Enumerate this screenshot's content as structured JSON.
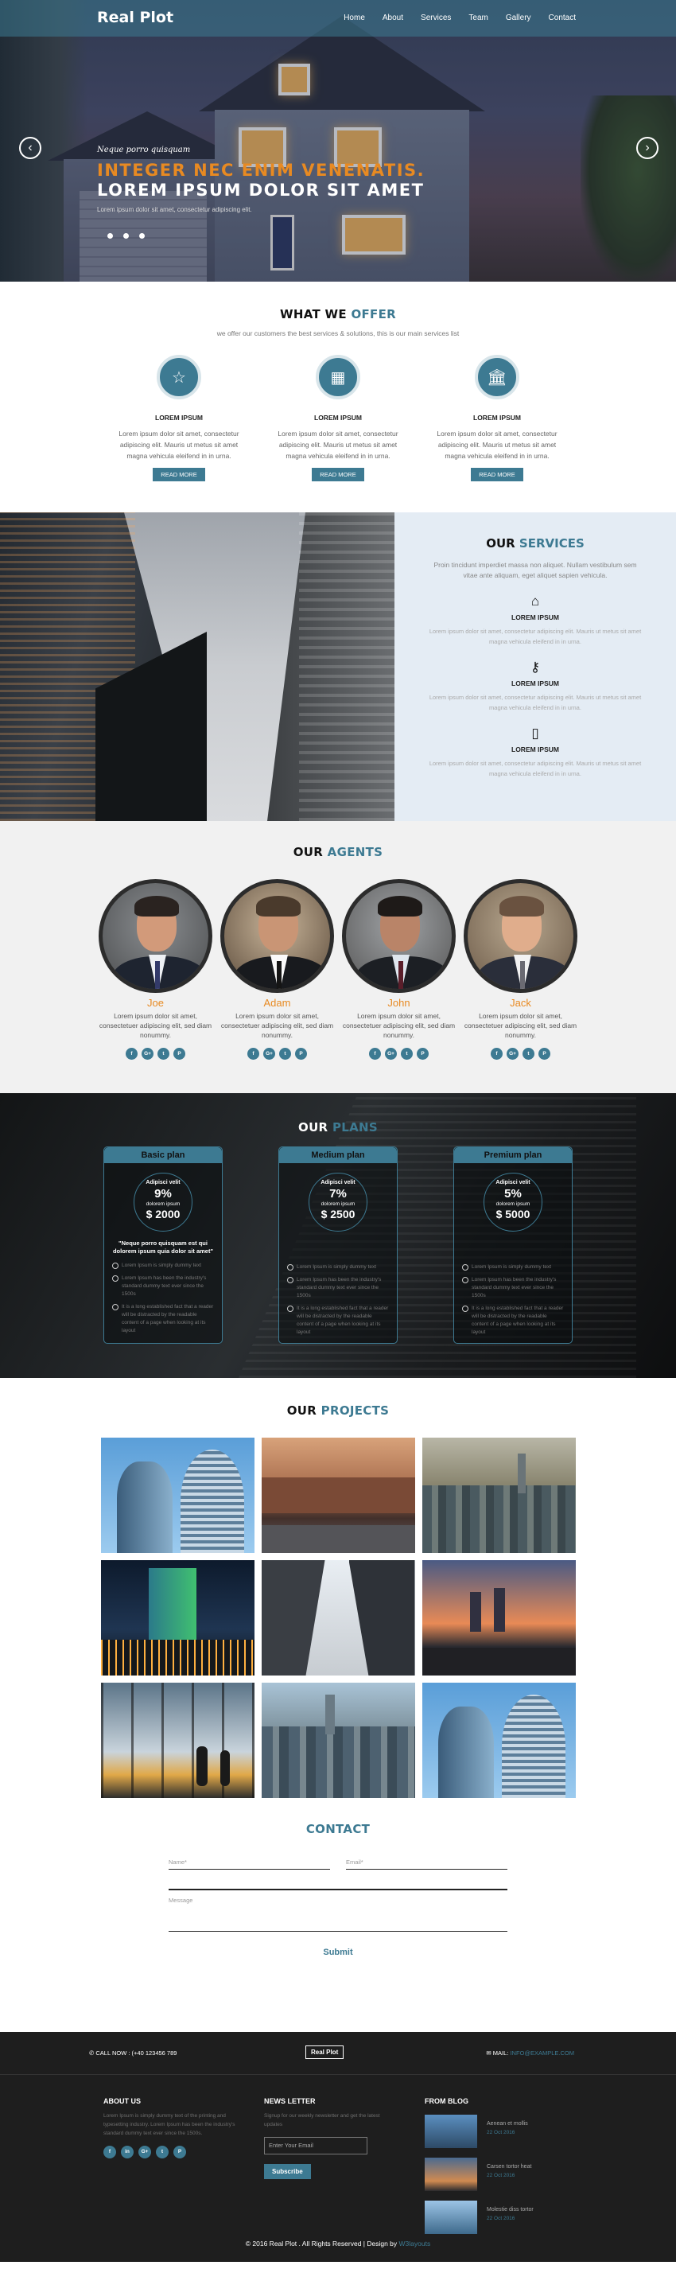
{
  "nav": {
    "logo": "Real Plot",
    "items": [
      "Home",
      "About",
      "Services",
      "Team",
      "Gallery",
      "Contact"
    ]
  },
  "hero": {
    "kicker": "Neque porro quisquam",
    "headline_a": "INTEGER NEC ENIM VENENATIS.",
    "headline_b": "LOREM IPSUM DOLOR SIT AMET",
    "text": "Lorem ipsum dolor sit amet, consectetur adipiscing elit.",
    "prev": "‹",
    "next": "›"
  },
  "offer": {
    "title_a": "WHAT WE",
    "title_b": "OFFER",
    "subtitle": "we offer our customers the best services & solutions, this is our main services list",
    "cards": [
      {
        "icon": "star-icon",
        "glyph": "☆",
        "title": "LOREM IPSUM",
        "text": "Lorem ipsum dolor sit amet, consectetur adipiscing elit. Mauris ut metus sit amet magna vehicula eleifend in in urna.",
        "button": "READ MORE"
      },
      {
        "icon": "map-icon",
        "glyph": "▦",
        "title": "LOREM IPSUM",
        "text": "Lorem ipsum dolor sit amet, consectetur adipiscing elit. Mauris ut metus sit amet magna vehicula eleifend in in urna.",
        "button": "READ MORE"
      },
      {
        "icon": "bank-icon",
        "glyph": "🏛",
        "title": "LOREM IPSUM",
        "text": "Lorem ipsum dolor sit amet, consectetur adipiscing elit. Mauris ut metus sit amet magna vehicula eleifend in in urna.",
        "button": "READ MORE"
      }
    ]
  },
  "services": {
    "title_a": "OUR",
    "title_b": "SERVICES",
    "lead": "Proin tincidunt imperdiet massa non aliquet. Nullam vestibulum sem vitae ante aliquam, eget aliquet sapien vehicula.",
    "items": [
      {
        "icon": "home-icon",
        "glyph": "⌂",
        "title": "LOREM IPSUM",
        "text": "Lorem ipsum dolor sit amet, consectetur adipiscing elit. Mauris ut metus sit amet magna vehicula eleifend in in urna."
      },
      {
        "icon": "key-icon",
        "glyph": "⚷",
        "title": "LOREM IPSUM",
        "text": "Lorem ipsum dolor sit amet, consectetur adipiscing elit. Mauris ut metus sit amet magna vehicula eleifend in in urna."
      },
      {
        "icon": "tablet-icon",
        "glyph": "▯",
        "title": "LOREM IPSUM",
        "text": "Lorem ipsum dolor sit amet, consectetur adipiscing elit. Mauris ut metus sit amet magna vehicula eleifend in in urna."
      }
    ]
  },
  "agents": {
    "title_a": "OUR",
    "title_b": "AGENTS",
    "list": [
      {
        "name": "Joe",
        "text": "Lorem ipsum dolor sit amet, consectetuer adipiscing elit, sed diam nonummy."
      },
      {
        "name": "Adam",
        "text": "Lorem ipsum dolor sit amet, consectetuer adipiscing elit, sed diam nonummy."
      },
      {
        "name": "John",
        "text": "Lorem ipsum dolor sit amet, consectetuer adipiscing elit, sed diam nonummy."
      },
      {
        "name": "Jack",
        "text": "Lorem ipsum dolor sit amet, consectetuer adipiscing elit, sed diam nonummy."
      }
    ],
    "social": [
      "f",
      "G+",
      "t",
      "P"
    ]
  },
  "plans": {
    "title_a": "OUR",
    "title_b": "PLANS",
    "list": [
      {
        "name": "Basic plan",
        "label": "Adipisci velit",
        "percent": "9%",
        "sublabel": "dolorem ipsum",
        "price": "$ 2000",
        "quote": "\"Neque porro quisquam est qui dolorem ipsum quia dolor sit amet\"",
        "features": [
          "Lorem Ipsum is simply dummy text",
          "Lorem Ipsum has been the industry's standard dummy text ever since the 1500s",
          "It is a long established fact that a reader will be distracted by the readable content of a page when looking at its layout"
        ]
      },
      {
        "name": "Medium plan",
        "label": "Adipisci velit",
        "percent": "7%",
        "sublabel": "dolorem ipsum",
        "price": "$ 2500",
        "quote": "",
        "features": [
          "Lorem Ipsum is simply dummy text",
          "Lorem Ipsum has been the industry's standard dummy text ever since the 1500s",
          "It is a long established fact that a reader will be distracted by the readable content of a page when looking at its layout"
        ]
      },
      {
        "name": "Premium plan",
        "label": "Adipisci velit",
        "percent": "5%",
        "sublabel": "dolorem ipsum",
        "price": "$ 5000",
        "quote": "",
        "features": [
          "Lorem Ipsum is simply dummy text",
          "Lorem Ipsum has been the industry's standard dummy text ever since the 1500s",
          "It is a long established fact that a reader will be distracted by the readable content of a page when looking at its layout"
        ]
      }
    ]
  },
  "projects": {
    "title_a": "OUR",
    "title_b": "PROJECTS"
  },
  "contact": {
    "title": "CONTACT",
    "name_placeholder": "Name*",
    "email_placeholder": "Email*",
    "message_placeholder": "Message",
    "submit": "Submit"
  },
  "footer": {
    "call": "CALL NOW : (+40 123456 789",
    "logo": "Real Plot",
    "mail_label": "MAIL:",
    "mail_value": "INFO@EXAMPLE.COM",
    "about_title": "ABOUT US",
    "about_text": "Lorem Ipsum is simply dummy text of the printing and typesetting industry. Lorem Ipsum has been the industry's standard dummy text ever since the 1500s.",
    "social": [
      "f",
      "in",
      "G+",
      "t",
      "P"
    ],
    "news_title": "NEWS LETTER",
    "news_text": "Signup for our weekly newsletter and get the latest updates",
    "email_placeholder": "Enter Your Email",
    "subscribe": "Subscribe",
    "blog_title": "FROM BLOG",
    "blog": [
      {
        "title": "Aenean et mollis",
        "date": "22 Oct 2016"
      },
      {
        "title": "Carsen tortor heat",
        "date": "22 Oct 2016"
      },
      {
        "title": "Molestie diss tortor",
        "date": "22 Oct 2016"
      }
    ],
    "copyright": "© 2016 Real Plot . All Rights Reserved | Design by",
    "designer": "W3layouts"
  }
}
